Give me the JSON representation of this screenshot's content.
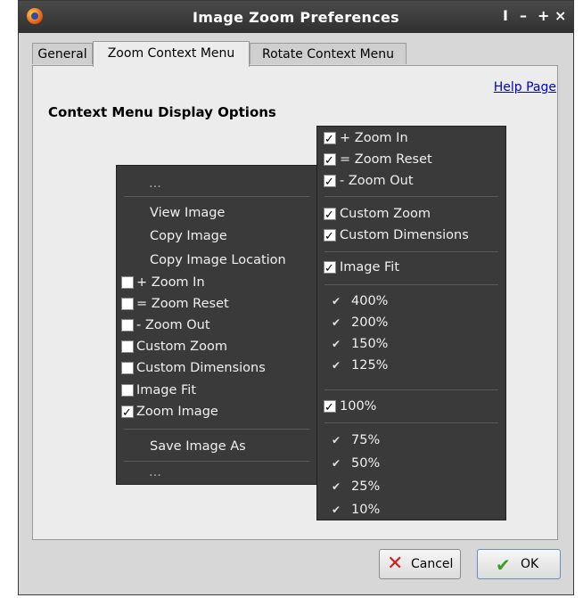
{
  "window": {
    "title": "Image Zoom Preferences",
    "controls": [
      "I",
      "–",
      "+",
      "×"
    ]
  },
  "tabs": [
    "General",
    "Zoom Context Menu",
    "Rotate Context Menu"
  ],
  "help_link": "Help Page",
  "heading": "Context Menu Display Options",
  "left_menu": {
    "top_ellipsis": "...",
    "view_image": "View Image",
    "copy_image": "Copy Image",
    "copy_location": "Copy Image Location",
    "zoom_in": "+ Zoom In",
    "zoom_reset": "= Zoom Reset",
    "zoom_out": "- Zoom Out",
    "custom_zoom": "Custom Zoom",
    "custom_dims": "Custom Dimensions",
    "image_fit": "Image Fit",
    "zoom_image": "Zoom Image",
    "save_as": "Save Image As",
    "bottom_ellipsis": "..."
  },
  "right_menu": {
    "zoom_in": "+ Zoom In",
    "zoom_reset": "= Zoom Reset",
    "zoom_out": "- Zoom Out",
    "custom_zoom": "Custom Zoom",
    "custom_dims": "Custom Dimensions",
    "image_fit": "Image Fit",
    "p400": "400%",
    "p200": "200%",
    "p150": "150%",
    "p125": "125%",
    "p100": "100%",
    "p75": "75%",
    "p50": "50%",
    "p25": "25%",
    "p10": "10%"
  },
  "buttons": {
    "cancel": "Cancel",
    "ok": "OK"
  }
}
